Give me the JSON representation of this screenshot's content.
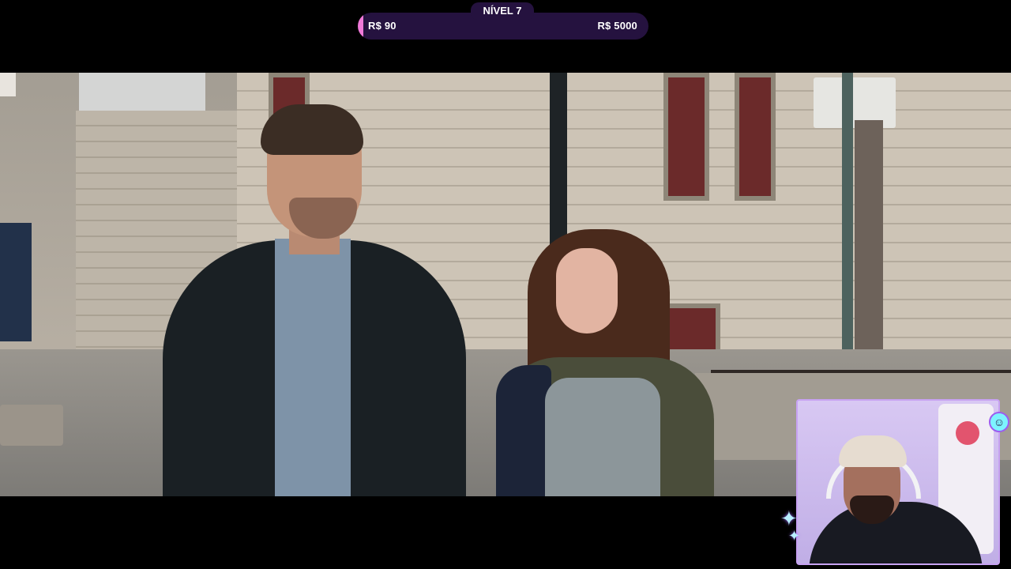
{
  "goal_bar": {
    "level_label": "NÍVEL 7",
    "current_amount": "R$ 90",
    "target_amount": "R$ 5000",
    "progress": 0.018,
    "fill_color": "#f07ad8",
    "bar_color": "#25123f"
  },
  "video": {
    "description_icon": "movie-scene"
  },
  "webcam": {
    "border_color": "#c7a2f2",
    "decorations": [
      "sparkle-icon",
      "smiley-icon"
    ]
  }
}
